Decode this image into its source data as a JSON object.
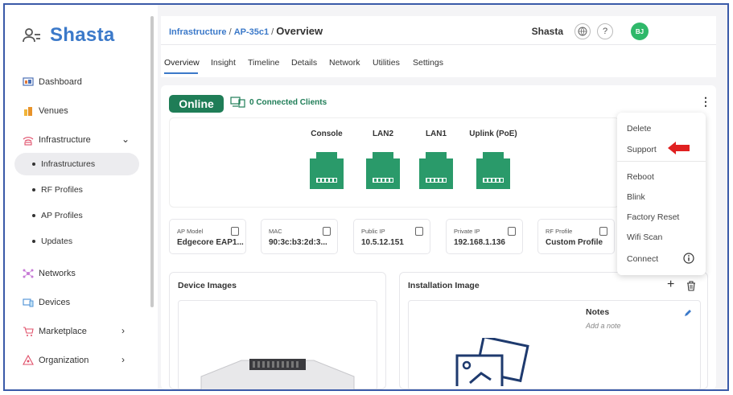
{
  "brand": {
    "name": "Shasta"
  },
  "sidebar": {
    "items": [
      {
        "label": "Dashboard",
        "icon": "dashboard-icon"
      },
      {
        "label": "Venues",
        "icon": "venues-icon"
      },
      {
        "label": "Infrastructure",
        "icon": "wifi-icon"
      },
      {
        "label": "Networks",
        "icon": "networks-icon"
      },
      {
        "label": "Devices",
        "icon": "devices-icon"
      },
      {
        "label": "Marketplace",
        "icon": "cart-icon"
      },
      {
        "label": "Organization",
        "icon": "organization-icon"
      }
    ],
    "sub_items": [
      {
        "label": "Infrastructures"
      },
      {
        "label": "RF Profiles"
      },
      {
        "label": "AP Profiles"
      },
      {
        "label": "Updates"
      }
    ]
  },
  "header": {
    "breadcrumb_root": "Infrastructure",
    "breadcrumb_device": "AP-35c1",
    "breadcrumb_current": "Overview",
    "org_name": "Shasta",
    "avatar_initials": "BJ",
    "help_symbol": "?"
  },
  "tabs": [
    "Overview",
    "Insight",
    "Timeline",
    "Details",
    "Network",
    "Utilities",
    "Settings"
  ],
  "device": {
    "status": "Online",
    "clients": "0 Connected Clients",
    "kebab": "⋮",
    "ports": [
      "Console",
      "LAN2",
      "LAN1",
      "Uplink (PoE)"
    ],
    "port_color": "#2a9a6a",
    "status_color": "#1f7d57"
  },
  "info": [
    {
      "key": "AP Model",
      "value": "Edgecore EAP1..."
    },
    {
      "key": "MAC",
      "value": "90:3c:b3:2d:3..."
    },
    {
      "key": "Public IP",
      "value": "10.5.12.151"
    },
    {
      "key": "Private IP",
      "value": "192.168.1.136"
    },
    {
      "key": "RF Profile",
      "value": "Custom Profile"
    }
  ],
  "panels": {
    "device_images": "Device Images",
    "installation_image": "Installation Image",
    "notes_title": "Notes",
    "notes_placeholder": "Add a note",
    "add_symbol": "+"
  },
  "menu": {
    "items": [
      "Delete",
      "Support",
      "Reboot",
      "Blink",
      "Factory Reset",
      "Wifi Scan",
      "Connect"
    ]
  },
  "colors": {
    "accent": "#3b79c9",
    "annotation_arrow": "#e02020"
  }
}
